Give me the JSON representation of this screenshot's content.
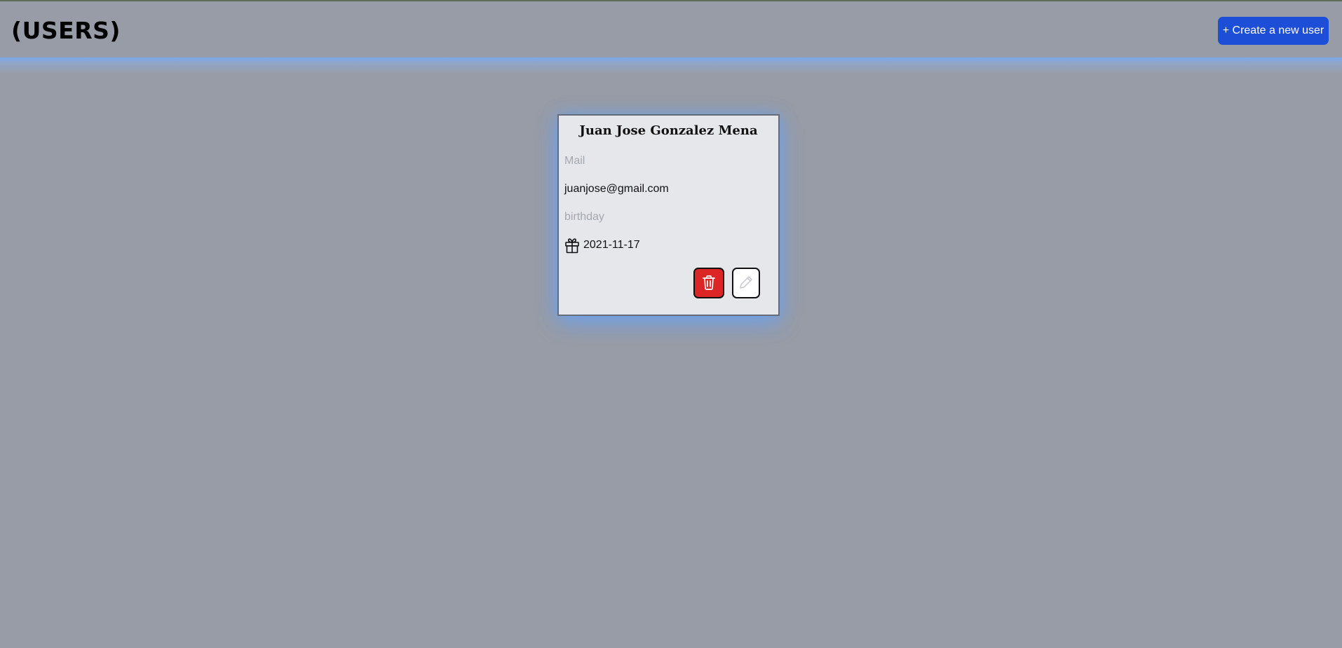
{
  "header": {
    "title": "(USERS)",
    "create_button_label": "+ Create a new user"
  },
  "user_card": {
    "name": "Juan Jose Gonzalez Mena",
    "mail_label": "Mail",
    "mail_value": "juanjose@gmail.com",
    "birthday_label": "birthday",
    "birthday_value": "2021-11-17",
    "icons": {
      "birthday": "gift-icon",
      "delete": "trash-icon",
      "edit": "pencil-icon"
    }
  },
  "colors": {
    "page_background": "#989ca6",
    "primary_button": "#1d4ed8",
    "delete_button": "#dc2626",
    "card_background": "#e5e7eb",
    "glow": "#78aaf0"
  }
}
